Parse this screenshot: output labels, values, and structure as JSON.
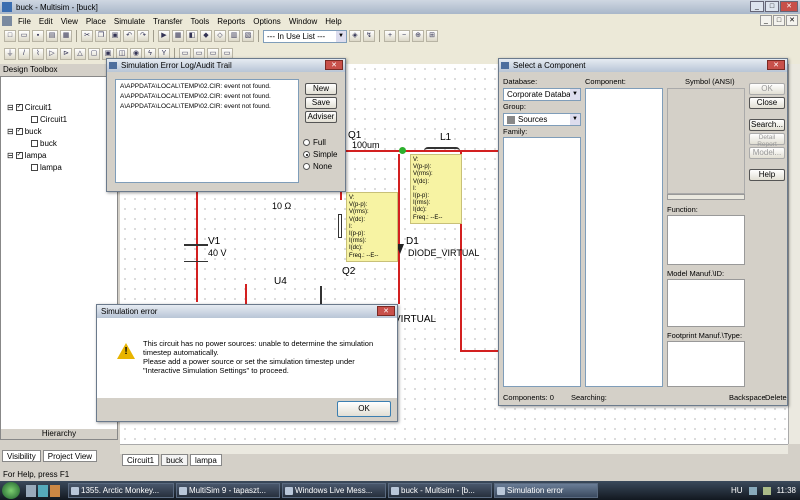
{
  "window": {
    "title": "buck - Multisim - [buck]",
    "min": "_",
    "max": "□",
    "close": "✕"
  },
  "menu": [
    "File",
    "Edit",
    "View",
    "Place",
    "Simulate",
    "Transfer",
    "Tools",
    "Reports",
    "Options",
    "Window",
    "Help"
  ],
  "toolbar": {
    "in_use_list": "--- In Use List ---"
  },
  "design_toolbox": {
    "title": "Design Toolbox",
    "tree": [
      {
        "label": "Circuit1",
        "level": 0
      },
      {
        "label": "Circuit1",
        "level": 1
      },
      {
        "label": "buck",
        "level": 0
      },
      {
        "label": "buck",
        "level": 1
      },
      {
        "label": "lampa",
        "level": 0
      },
      {
        "label": "lampa",
        "level": 1
      }
    ],
    "hierarchy_label": "Hierarchy",
    "tabs": [
      "Visibility",
      "Project View"
    ]
  },
  "sheet_tabs": [
    "Circuit1",
    "buck",
    "lampa"
  ],
  "status": "For Help, press F1",
  "schematic": {
    "q1": "Q1",
    "ind_value": "100um",
    "l1": "L1",
    "res_value": "10 Ω",
    "v1": "V1",
    "v1_value": "40 V",
    "d1": "D1",
    "d1_model": "DIODE_VIRTUAL",
    "u4": "U4",
    "q2": "Q2",
    "virtual_frag": "VIRTUAL",
    "probe": "V:\nV(p-p):\nV(rms):\nV(dc):\nI:\nI(p-p):\nI(rms):\nI(dc):\nFreq.: --E--"
  },
  "error_log": {
    "title": "Simulation Error Log/Audit Trail",
    "lines": [
      "A\\APPDATA\\LOCAL\\TEMP\\02.CIR: event not found.",
      "A\\APPDATA\\LOCAL\\TEMP\\02.CIR: event not found.",
      "A\\APPDATA\\LOCAL\\TEMP\\02.CIR: event not found."
    ],
    "buttons": [
      "New",
      "Save",
      "Adviser"
    ],
    "modes": [
      "Full",
      "Simple",
      "None"
    ],
    "selected_mode": "Simple"
  },
  "select_component": {
    "title": "Select a Component",
    "database_label": "Database:",
    "database_value": "Corporate Database",
    "group_label": "Group:",
    "group_value": "Sources",
    "family_label": "Family:",
    "component_label": "Component:",
    "symbol_label": "Symbol (ANSI)",
    "function_label": "Function:",
    "model_label": "Model Manuf.\\ID:",
    "footprint_label": "Footprint Manuf.\\Type:",
    "components_count": "Components: 0",
    "searching": "Searching:",
    "backspace": "Backspace",
    "delete": "Delete",
    "buttons": {
      "ok": "OK",
      "close": "Close",
      "search": "Search...",
      "detail": "Detail Report",
      "model": "Model...",
      "help": "Help"
    }
  },
  "sim_error": {
    "title": "Simulation error",
    "message": "This circuit has no power sources: unable to determine the simulation timestep automatically.\nPlease add a power source or set the simulation timestep under \"Interactive Simulation Settings\" to proceed.",
    "ok": "OK"
  },
  "taskbar": {
    "items": [
      "1355. Arctic Monkey...",
      "MultiSim 9 - tapaszt...",
      "Windows Live Mess...",
      "buck - Multisim - [b...",
      "Simulation error"
    ],
    "lang": "HU",
    "time": "11:38"
  }
}
